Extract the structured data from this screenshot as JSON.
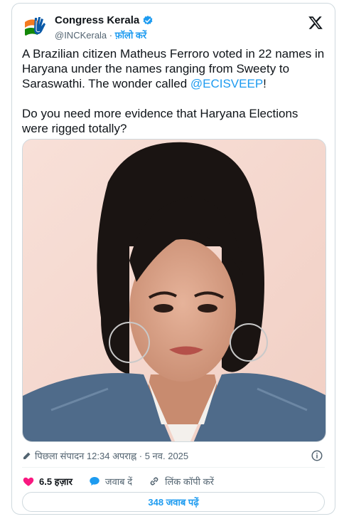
{
  "account": {
    "display_name": "Congress Kerala",
    "handle": "@INCKerala",
    "separator": " · ",
    "follow_label": "फ़ॉलो करें"
  },
  "tweet": {
    "text_part1": "A Brazilian citizen Matheus Ferroro voted in 22 names in Haryana under the names ranging from Sweety to Saraswathi. The wonder called ",
    "mention": "@ECISVEEP",
    "text_part2": "!\n\nDo you need more evidence that Haryana Elections were rigged totally?"
  },
  "meta": {
    "edited_label": "पिछला संपादन 12:34 अपराह्न · 5 नव. 2025"
  },
  "actions": {
    "like_count": "6.5 हज़ार",
    "reply_label": "जवाब दें",
    "copy_link_label": "लिंक कॉपी करें"
  },
  "replies_button_label": "348 जवाब पढ़ें",
  "colors": {
    "accent": "#1d9bf0",
    "like": "#f91880",
    "text": "#0f1419",
    "muted": "#536471",
    "border": "#cfd9de"
  },
  "icons": {
    "logo": "congress-hand-logo",
    "verified": "verified-badge-icon",
    "brand": "x-logo-icon",
    "edit": "pencil-icon",
    "info": "info-icon",
    "like": "heart-icon",
    "reply": "speech-bubble-icon",
    "link": "link-icon"
  }
}
